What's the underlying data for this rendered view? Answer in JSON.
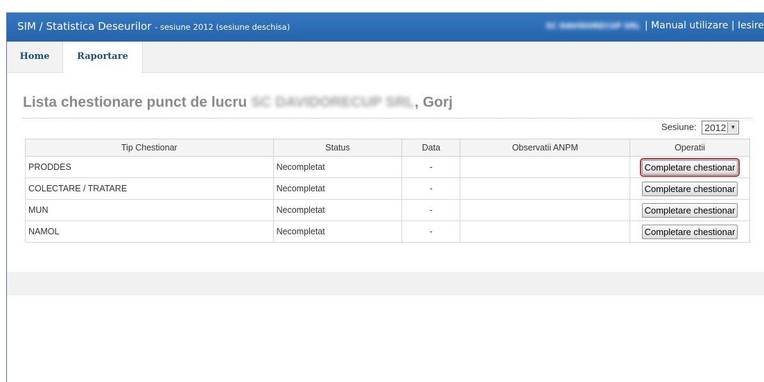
{
  "header": {
    "app_title": "SIM / Statistica Deseurilor",
    "session_info": " - sesiune 2012 (sesiune deschisa)",
    "company": "SC DAVIDORECUP SRL",
    "separator1": " | ",
    "manual_link": "Manual utilizare",
    "separator2": " | ",
    "exit_link": "Iesire"
  },
  "nav": {
    "tabs": [
      {
        "label": "Home",
        "active": false
      },
      {
        "label": "Raportare",
        "active": true
      }
    ]
  },
  "page": {
    "title_prefix": "Lista chestionare punct de lucru ",
    "title_company": "SC DAVIDORECUP SRL",
    "title_suffix": ", Gorj"
  },
  "session": {
    "label": "Sesiune:",
    "selected": "2012"
  },
  "table": {
    "headers": [
      "Tip Chestionar",
      "Status",
      "Data",
      "Observatii ANPM",
      "Operatii"
    ],
    "rows": [
      {
        "tip": "PRODDES",
        "status": "Necompletat",
        "data": "-",
        "observatii": "",
        "action": "Completare chestionar"
      },
      {
        "tip": "COLECTARE / TRATARE",
        "status": "Necompletat",
        "data": "-",
        "observatii": "",
        "action": "Completare chestionar"
      },
      {
        "tip": "MUN",
        "status": "Necompletat",
        "data": "-",
        "observatii": "",
        "action": "Completare chestionar"
      },
      {
        "tip": "NAMOL",
        "status": "Necompletat",
        "data": "-",
        "observatii": "",
        "action": "Completare chestionar"
      }
    ]
  },
  "colors": {
    "header_bg": "#2a6cb5",
    "nav_text": "#1b4f8a",
    "highlight": "#d62b2b"
  }
}
